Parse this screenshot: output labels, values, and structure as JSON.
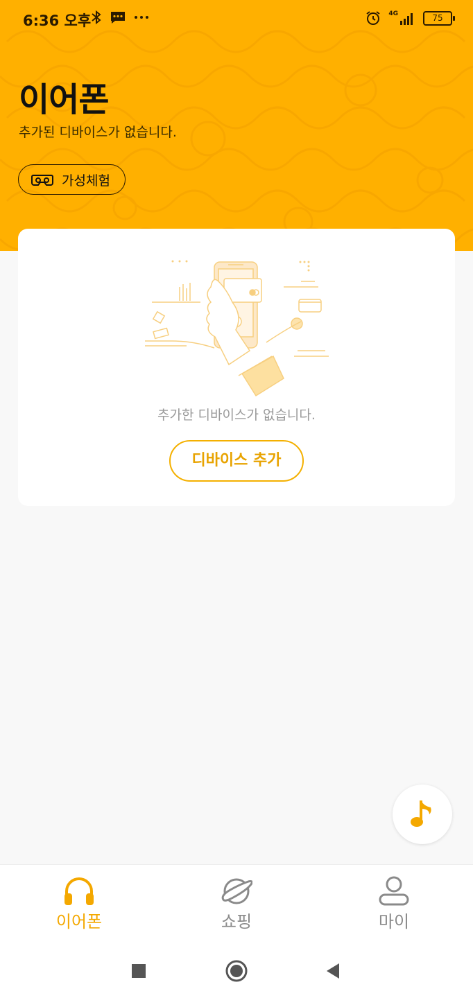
{
  "status_bar": {
    "time": "6:36 오후",
    "network": "4G",
    "battery": "75"
  },
  "header": {
    "title": "이어폰",
    "subtitle": "추가된 디바이스가 없습니다.",
    "trial_button_label": "가성체험"
  },
  "card": {
    "empty_message": "추가한 디바이스가 없습니다.",
    "add_device_label": "디바이스 추가"
  },
  "bottom_nav": {
    "items": [
      {
        "label": "이어폰",
        "icon": "headphones-icon",
        "active": true
      },
      {
        "label": "쇼핑",
        "icon": "planet-icon",
        "active": false
      },
      {
        "label": "마이",
        "icon": "person-icon",
        "active": false
      }
    ]
  },
  "colors": {
    "accent": "#ffb000",
    "accent_text": "#f4a800",
    "inactive": "#8a8a8a"
  }
}
